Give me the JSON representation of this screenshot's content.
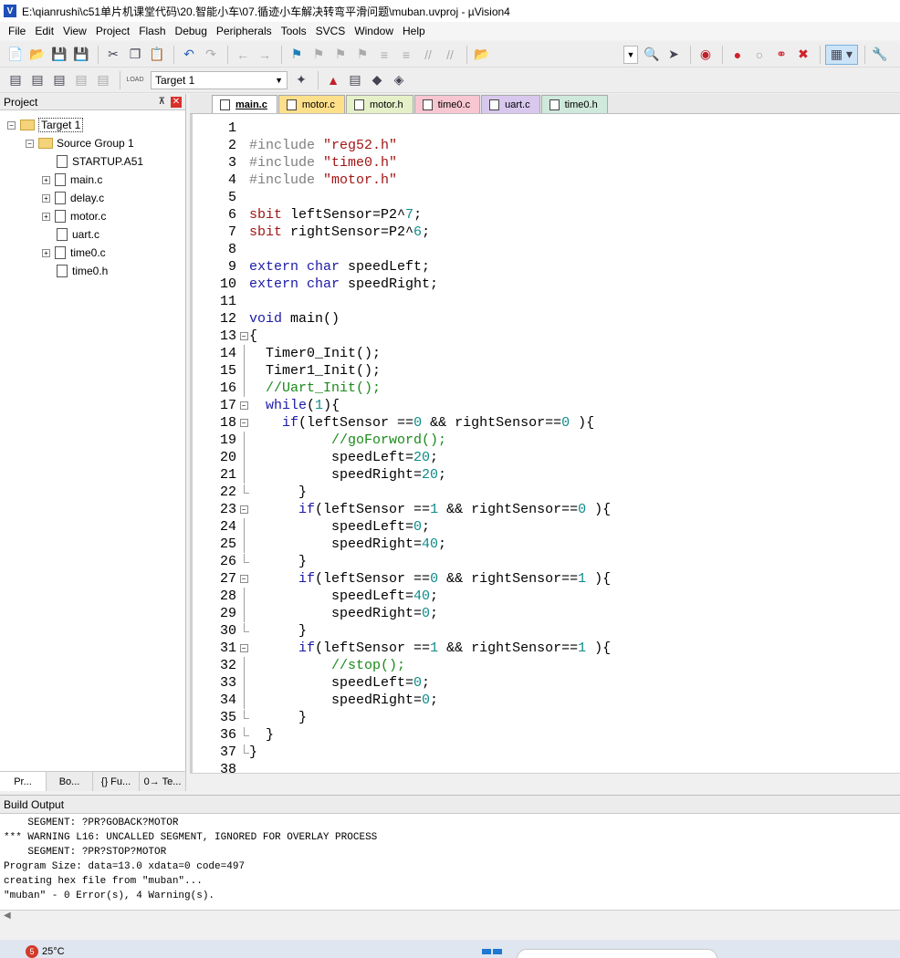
{
  "window": {
    "title": "E:\\qianrushi\\c51单片机课堂代码\\20.智能小车\\07.循迹小车解决转弯平滑问题\\muban.uvproj - µVision4",
    "icon_label": "V"
  },
  "menu": [
    "File",
    "Edit",
    "View",
    "Project",
    "Flash",
    "Debug",
    "Peripherals",
    "Tools",
    "SVCS",
    "Window",
    "Help"
  ],
  "toolbar": {
    "target_combo": "Target 1",
    "load_label": "LOAD"
  },
  "project_panel": {
    "title": "Project",
    "pin_glyph": "⊼",
    "close_glyph": "✕",
    "tree": {
      "target": "Target 1",
      "group": "Source Group 1",
      "files": [
        "STARTUP.A51",
        "main.c",
        "delay.c",
        "motor.c",
        "uart.c",
        "time0.c",
        "time0.h"
      ]
    },
    "tabs": [
      "Pr...",
      "Bo...",
      "{} Fu...",
      "0→ Te..."
    ]
  },
  "editor": {
    "tabs": [
      {
        "label": "main.c",
        "color": "#ffffff"
      },
      {
        "label": "motor.c",
        "color": "#ffe08a"
      },
      {
        "label": "motor.h",
        "color": "#e5f0c8"
      },
      {
        "label": "time0.c",
        "color": "#f7c6d1"
      },
      {
        "label": "uart.c",
        "color": "#d8c8ee"
      },
      {
        "label": "time0.h",
        "color": "#cfe9dc"
      }
    ],
    "line_numbers": [
      "1",
      "2",
      "3",
      "4",
      "5",
      "6",
      "7",
      "8",
      "9",
      "10",
      "11",
      "12",
      "13",
      "14",
      "15",
      "16",
      "17",
      "18",
      "19",
      "20",
      "21",
      "22",
      "23",
      "24",
      "25",
      "26",
      "27",
      "28",
      "29",
      "30",
      "31",
      "32",
      "33",
      "34",
      "35",
      "36",
      "37",
      "38"
    ],
    "code_lines": [
      [],
      [
        {
          "t": "#include ",
          "c": "pp"
        },
        {
          "t": "\"reg52.h\"",
          "c": "str"
        }
      ],
      [
        {
          "t": "#include ",
          "c": "pp"
        },
        {
          "t": "\"time0.h\"",
          "c": "str"
        }
      ],
      [
        {
          "t": "#include ",
          "c": "pp"
        },
        {
          "t": "\"motor.h\"",
          "c": "str"
        }
      ],
      [],
      [
        {
          "t": "sbit ",
          "c": "str"
        },
        {
          "t": "leftSensor=P2^",
          "c": ""
        },
        {
          "t": "7",
          "c": "num"
        },
        {
          "t": ";",
          "c": ""
        }
      ],
      [
        {
          "t": "sbit ",
          "c": "str"
        },
        {
          "t": "rightSensor=P2^",
          "c": ""
        },
        {
          "t": "6",
          "c": "num"
        },
        {
          "t": ";",
          "c": ""
        }
      ],
      [],
      [
        {
          "t": "extern ",
          "c": "kw"
        },
        {
          "t": "char ",
          "c": "kw"
        },
        {
          "t": "speedLeft;",
          "c": ""
        }
      ],
      [
        {
          "t": "extern ",
          "c": "kw"
        },
        {
          "t": "char ",
          "c": "kw"
        },
        {
          "t": "speedRight;",
          "c": ""
        }
      ],
      [],
      [
        {
          "t": "void ",
          "c": "kw"
        },
        {
          "t": "main()",
          "c": ""
        }
      ],
      [
        {
          "t": "{",
          "c": ""
        }
      ],
      [
        {
          "t": "  Timer0_Init();",
          "c": ""
        }
      ],
      [
        {
          "t": "  Timer1_Init();",
          "c": ""
        }
      ],
      [
        {
          "t": "  //Uart_Init();",
          "c": "cm"
        }
      ],
      [
        {
          "t": "  ",
          "c": ""
        },
        {
          "t": "while",
          "c": "kw"
        },
        {
          "t": "(",
          "c": ""
        },
        {
          "t": "1",
          "c": "num"
        },
        {
          "t": "){",
          "c": ""
        }
      ],
      [
        {
          "t": "    ",
          "c": ""
        },
        {
          "t": "if",
          "c": "kw"
        },
        {
          "t": "(leftSensor ==",
          "c": ""
        },
        {
          "t": "0",
          "c": "num"
        },
        {
          "t": " && rightSensor==",
          "c": ""
        },
        {
          "t": "0",
          "c": "num"
        },
        {
          "t": " ){",
          "c": ""
        }
      ],
      [
        {
          "t": "          //goForword();",
          "c": "cm"
        }
      ],
      [
        {
          "t": "          speedLeft=",
          "c": ""
        },
        {
          "t": "20",
          "c": "num"
        },
        {
          "t": ";",
          "c": ""
        }
      ],
      [
        {
          "t": "          speedRight=",
          "c": ""
        },
        {
          "t": "20",
          "c": "num"
        },
        {
          "t": ";",
          "c": ""
        }
      ],
      [
        {
          "t": "      }",
          "c": ""
        }
      ],
      [
        {
          "t": "      ",
          "c": ""
        },
        {
          "t": "if",
          "c": "kw"
        },
        {
          "t": "(leftSensor ==",
          "c": ""
        },
        {
          "t": "1",
          "c": "num"
        },
        {
          "t": " && rightSensor==",
          "c": ""
        },
        {
          "t": "0",
          "c": "num"
        },
        {
          "t": " ){",
          "c": ""
        }
      ],
      [
        {
          "t": "          speedLeft=",
          "c": ""
        },
        {
          "t": "0",
          "c": "num"
        },
        {
          "t": ";",
          "c": ""
        }
      ],
      [
        {
          "t": "          speedRight=",
          "c": ""
        },
        {
          "t": "40",
          "c": "num"
        },
        {
          "t": ";",
          "c": ""
        }
      ],
      [
        {
          "t": "      }",
          "c": ""
        }
      ],
      [
        {
          "t": "      ",
          "c": ""
        },
        {
          "t": "if",
          "c": "kw"
        },
        {
          "t": "(leftSensor ==",
          "c": ""
        },
        {
          "t": "0",
          "c": "num"
        },
        {
          "t": " && rightSensor==",
          "c": ""
        },
        {
          "t": "1",
          "c": "num"
        },
        {
          "t": " ){",
          "c": ""
        }
      ],
      [
        {
          "t": "          speedLeft=",
          "c": ""
        },
        {
          "t": "40",
          "c": "num"
        },
        {
          "t": ";",
          "c": ""
        }
      ],
      [
        {
          "t": "          speedRight=",
          "c": ""
        },
        {
          "t": "0",
          "c": "num"
        },
        {
          "t": ";",
          "c": ""
        }
      ],
      [
        {
          "t": "      }",
          "c": ""
        }
      ],
      [
        {
          "t": "      ",
          "c": ""
        },
        {
          "t": "if",
          "c": "kw"
        },
        {
          "t": "(leftSensor ==",
          "c": ""
        },
        {
          "t": "1",
          "c": "num"
        },
        {
          "t": " && rightSensor==",
          "c": ""
        },
        {
          "t": "1",
          "c": "num"
        },
        {
          "t": " ){",
          "c": ""
        }
      ],
      [
        {
          "t": "          //stop();",
          "c": "cm"
        }
      ],
      [
        {
          "t": "          speedLeft=",
          "c": ""
        },
        {
          "t": "0",
          "c": "num"
        },
        {
          "t": ";",
          "c": ""
        }
      ],
      [
        {
          "t": "          speedRight=",
          "c": ""
        },
        {
          "t": "0",
          "c": "num"
        },
        {
          "t": ";",
          "c": ""
        }
      ],
      [
        {
          "t": "      }",
          "c": ""
        }
      ],
      [
        {
          "t": "  }",
          "c": ""
        }
      ],
      [
        {
          "t": "}",
          "c": ""
        }
      ],
      []
    ],
    "fold_markers": [
      "",
      "",
      "",
      "",
      "",
      "",
      "",
      "",
      "",
      "",
      "",
      "",
      "box",
      "line",
      "line",
      "line",
      "box",
      "box",
      "line",
      "line",
      "line",
      "end",
      "box",
      "line",
      "line",
      "end",
      "box",
      "line",
      "line",
      "end",
      "box",
      "line",
      "line",
      "line",
      "end",
      "end",
      "end",
      ""
    ]
  },
  "build_output": {
    "title": "Build Output",
    "lines": [
      "    SEGMENT: ?PR?GOBACK?MOTOR",
      "*** WARNING L16: UNCALLED SEGMENT, IGNORED FOR OVERLAY PROCESS",
      "    SEGMENT: ?PR?STOP?MOTOR",
      "Program Size: data=13.0 xdata=0 code=497",
      "creating hex file from \"muban\"...",
      "\"muban\" - 0 Error(s), 4 Warning(s)."
    ]
  },
  "taskbar": {
    "badge": "5",
    "temperature": "25°C"
  }
}
